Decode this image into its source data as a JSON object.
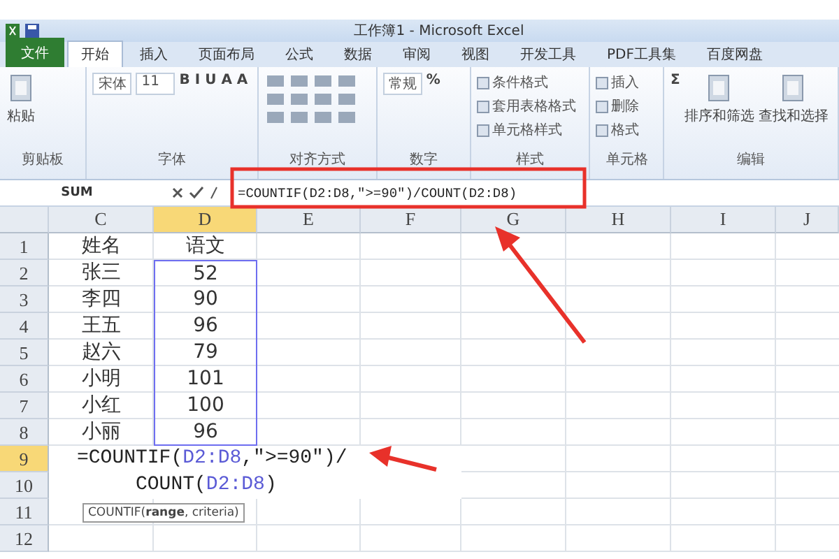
{
  "title_bar": {
    "title": "工作簿1 - Microsoft Excel"
  },
  "ribbon_tabs": [
    {
      "label": "文件",
      "kind": "file",
      "selected": false
    },
    {
      "label": "开始",
      "kind": "tab",
      "selected": true
    },
    {
      "label": "插入",
      "kind": "tab",
      "selected": false
    },
    {
      "label": "页面布局",
      "kind": "tab",
      "selected": false
    },
    {
      "label": "公式",
      "kind": "tab",
      "selected": false
    },
    {
      "label": "数据",
      "kind": "tab",
      "selected": false
    },
    {
      "label": "审阅",
      "kind": "tab",
      "selected": false
    },
    {
      "label": "视图",
      "kind": "tab",
      "selected": false
    },
    {
      "label": "开发工具",
      "kind": "tab",
      "selected": false
    },
    {
      "label": "PDF工具集",
      "kind": "tab",
      "selected": false
    },
    {
      "label": "百度网盘",
      "kind": "tab",
      "selected": false
    }
  ],
  "ribbon_groups": [
    {
      "label": "剪贴板",
      "controls": [
        {
          "kind": "big",
          "text": "粘贴"
        }
      ]
    },
    {
      "label": "字体",
      "controls": [
        {
          "kind": "field",
          "text": "宋体"
        },
        {
          "kind": "field",
          "text": "11"
        },
        {
          "kind": "glyphs",
          "text": "B I U A A"
        }
      ]
    },
    {
      "label": "对齐方式",
      "controls": [
        {
          "kind": "icons"
        }
      ]
    },
    {
      "label": "数字",
      "controls": [
        {
          "kind": "field",
          "text": "常规"
        },
        {
          "kind": "glyphs",
          "text": "%"
        }
      ]
    },
    {
      "label": "样式",
      "controls": [
        {
          "kind": "small",
          "text": "条件格式"
        },
        {
          "kind": "small",
          "text": "套用表格格式"
        },
        {
          "kind": "small",
          "text": "单元格样式"
        }
      ]
    },
    {
      "label": "单元格",
      "controls": [
        {
          "kind": "small",
          "text": "插入"
        },
        {
          "kind": "small",
          "text": "删除"
        },
        {
          "kind": "small",
          "text": "格式"
        }
      ]
    },
    {
      "label": "编辑",
      "controls": [
        {
          "kind": "glyphs",
          "text": "Σ"
        },
        {
          "kind": "big",
          "text": "排序和筛选"
        },
        {
          "kind": "big",
          "text": "查找和选择"
        }
      ]
    }
  ],
  "formula_bar": {
    "name_box": "SUM",
    "formula": "=COUNTIF(D2:D8,\">=90\")/COUNT(D2:D8)"
  },
  "columns": [
    {
      "label": "C",
      "selected": false
    },
    {
      "label": "D",
      "selected": true
    },
    {
      "label": "E",
      "selected": false
    },
    {
      "label": "F",
      "selected": false
    },
    {
      "label": "G",
      "selected": false
    },
    {
      "label": "H",
      "selected": false
    },
    {
      "label": "I",
      "selected": false
    },
    {
      "label": "J",
      "selected": false
    }
  ],
  "rows": [
    {
      "number": "1",
      "selected": false,
      "cells": [
        "姓名",
        "语文"
      ]
    },
    {
      "number": "2",
      "selected": false,
      "cells": [
        "张三",
        "52"
      ]
    },
    {
      "number": "3",
      "selected": false,
      "cells": [
        "李四",
        "90"
      ]
    },
    {
      "number": "4",
      "selected": false,
      "cells": [
        "王五",
        "96"
      ]
    },
    {
      "number": "5",
      "selected": false,
      "cells": [
        "赵六",
        "79"
      ]
    },
    {
      "number": "6",
      "selected": false,
      "cells": [
        "小明",
        "101"
      ]
    },
    {
      "number": "7",
      "selected": false,
      "cells": [
        "小红",
        "100"
      ]
    },
    {
      "number": "8",
      "selected": false,
      "cells": [
        "小丽",
        "96"
      ]
    },
    {
      "number": "9",
      "selected": true,
      "edit": [
        {
          "kind": "text",
          "text": "=COUNTIF("
        },
        {
          "kind": "ref",
          "text": "D2:D8"
        },
        {
          "kind": "text",
          "text": ",\">=90\")/"
        }
      ]
    },
    {
      "number": "10",
      "selected": false,
      "edit": [
        {
          "kind": "text",
          "text": "COUNT("
        },
        {
          "kind": "ref",
          "text": "D2:D8"
        },
        {
          "kind": "text",
          "text": ")"
        }
      ]
    },
    {
      "number": "11",
      "selected": false,
      "tooltip": "COUNTIF(**range**, criteria)"
    },
    {
      "number": "12",
      "selected": false
    }
  ]
}
